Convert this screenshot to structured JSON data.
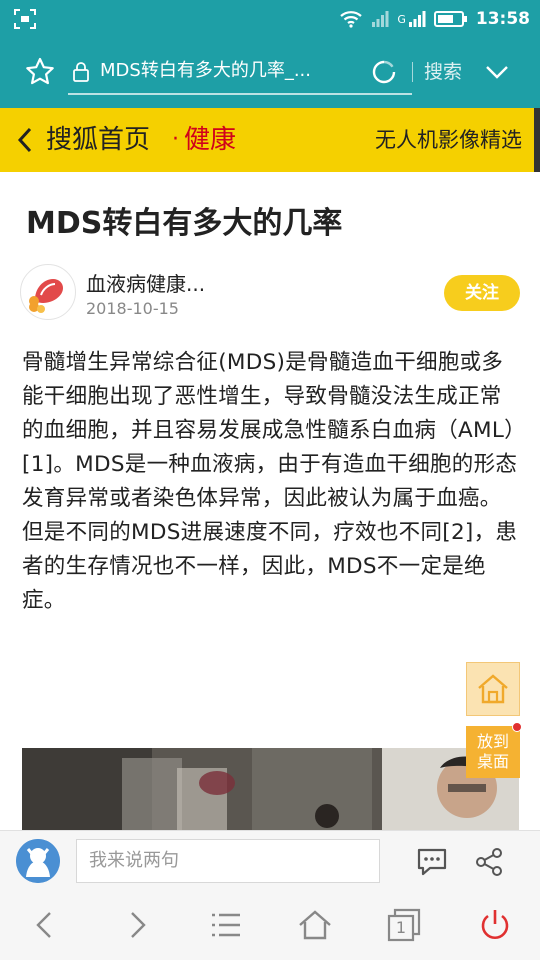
{
  "status_bar": {
    "time": "13:58",
    "network_label": "G",
    "icons": [
      "screenshot-icon",
      "wifi-icon",
      "signal-icon",
      "signal-icon",
      "battery-icon"
    ]
  },
  "address_bar": {
    "url_text": "MDS转白有多大的几率_...",
    "search_label": "搜索",
    "icons": [
      "star-icon",
      "lock-icon",
      "refresh-icon",
      "chevron-down-icon"
    ]
  },
  "channel_bar": {
    "brand": "搜狐首页",
    "dot": "·",
    "category": "健康",
    "right_link": "无人机影像精选",
    "colors": {
      "background": "#f5d000",
      "category": "#d0021b"
    }
  },
  "article": {
    "title": "MDS转白有多大的几率",
    "author": {
      "name": "血液病健康...",
      "date": "2018-10-15",
      "follow_label": "关注"
    },
    "body": "骨髓增生异常综合征(MDS)是骨髓造血干细胞或多能干细胞出现了恶性增生，导致骨髓没法生成正常的血细胞，并且容易发展成急性髓系白血病（AML）[1]。MDS是一种血液病，由于有造血干细胞的形态发育异常或者染色体异常，因此被认为属于血癌。但是不同的MDS进展速度不同，疗效也不同[2]，患者的生存情况也不一样，因此，MDS不一定是绝症。"
  },
  "floating": {
    "home_icon": "home-icon",
    "desktop_label": "放到\n桌面"
  },
  "comment_bar": {
    "placeholder": "我来说两句",
    "icons": [
      "avatar-icon",
      "comment-icon",
      "share-icon"
    ]
  },
  "nav_bar": {
    "icons": [
      "back-icon",
      "forward-icon",
      "menu-icon",
      "home-icon",
      "tabs-icon",
      "power-icon"
    ],
    "tab_count": "1"
  },
  "colors": {
    "accent": "#1e9fa6",
    "follow": "#f7cd1d",
    "power": "#e03030"
  }
}
